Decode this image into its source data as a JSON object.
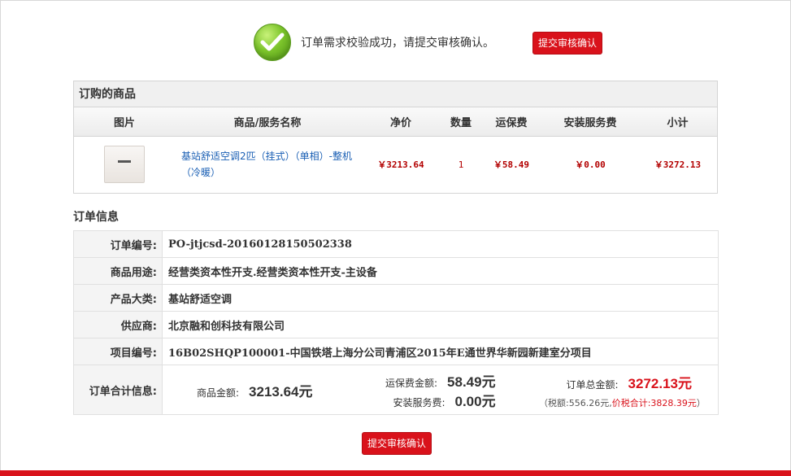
{
  "success": {
    "message": "订单需求校验成功，请提交审核确认。",
    "submit_label": "提交审核确认"
  },
  "products": {
    "title": "订购的商品",
    "headers": [
      "图片",
      "商品/服务名称",
      "净价",
      "数量",
      "运保费",
      "安装服务费",
      "小计"
    ],
    "rows": [
      {
        "image": "air-conditioner-image",
        "name": "基站舒适空调2匹（挂式）（单相）-整机（冷暖）",
        "net_price": "￥3213.64",
        "quantity": "1",
        "shipping": "￥58.49",
        "install": "￥0.00",
        "subtotal": "￥3272.13"
      }
    ]
  },
  "order_info": {
    "title": "订单信息",
    "rows": [
      {
        "label": "订单编号:",
        "value": "PO-jtjcsd-20160128150502338"
      },
      {
        "label": "商品用途:",
        "value": "经营类资本性开支.经营类资本性开支-主设备"
      },
      {
        "label": "产品大类:",
        "value": "基站舒适空调"
      },
      {
        "label": "供应商:",
        "value": "北京融和创科技有限公司"
      },
      {
        "label": "项目编号:",
        "value": "16B02SHQP100001-中国铁塔上海分公司青浦区2015年E通世界华新园新建室分项目"
      }
    ],
    "total": {
      "label": "订单合计信息:",
      "goods_label": "商品金额:",
      "goods_value": "3213.64元",
      "shipping_label": "运保费金额:",
      "shipping_value": "58.49元",
      "install_label": "安装服务费:",
      "install_value": "0.00元",
      "order_total_label": "订单总金额:",
      "order_total_value": "3272.13元",
      "tax_text": "（税额:556.26元,",
      "sum_text": "价税合计:3828.39元",
      "close_paren": "）"
    }
  },
  "submit_bottom_label": "提交审核确认",
  "colors": {
    "accent_red": "#d9121b",
    "link_blue": "#1a5fb4",
    "price_red": "#b30000"
  }
}
